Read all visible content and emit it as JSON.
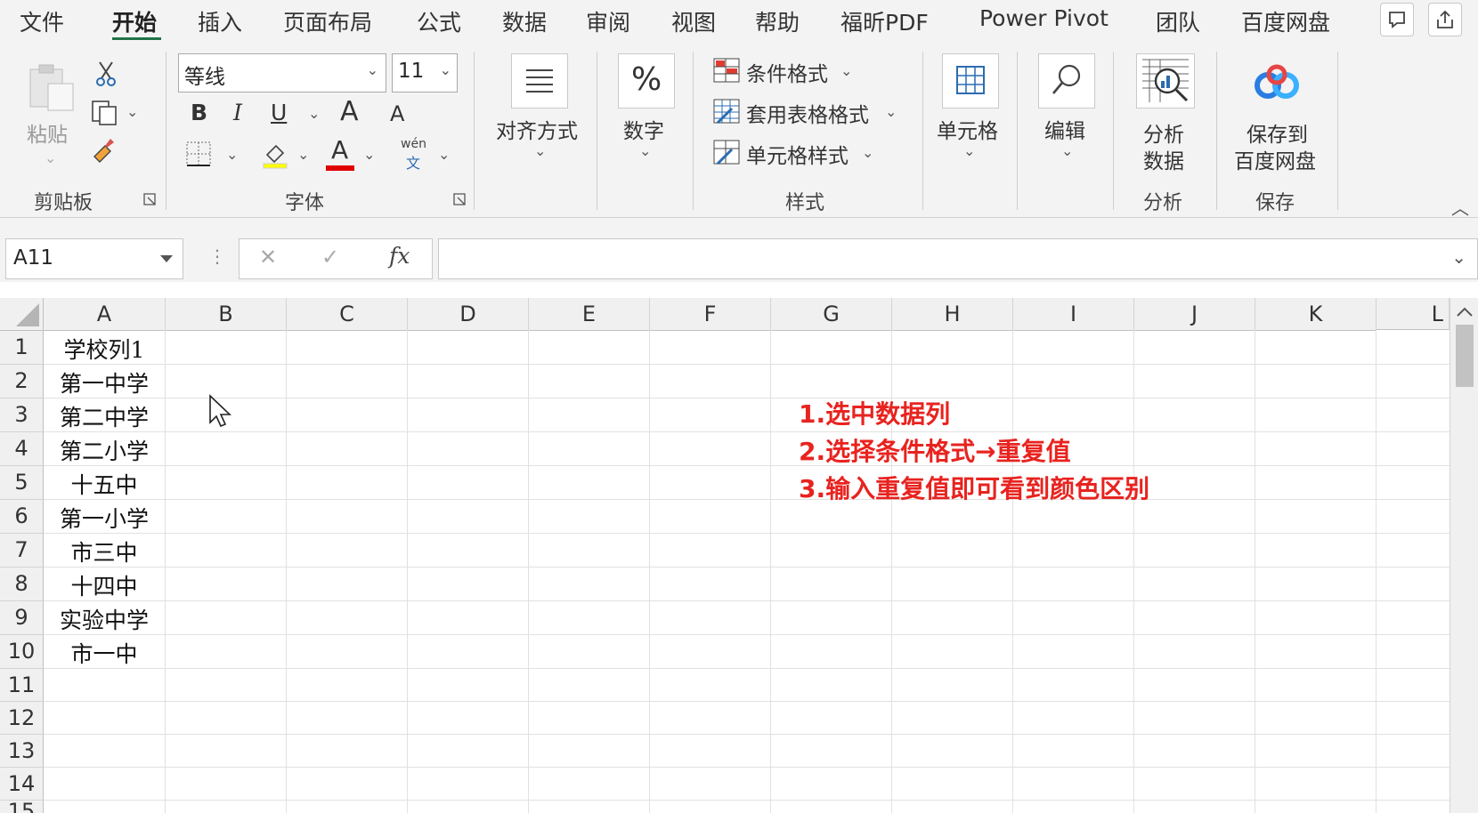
{
  "tabs": [
    "文件",
    "开始",
    "插入",
    "页面布局",
    "公式",
    "数据",
    "审阅",
    "视图",
    "帮助",
    "福昕PDF",
    "Power Pivot",
    "团队",
    "百度网盘"
  ],
  "active_tab": "开始",
  "ribbon": {
    "clipboard": {
      "paste_label": "粘贴",
      "group_label": "剪贴板"
    },
    "font": {
      "font_name": "等线",
      "font_size": "11",
      "group_label": "字体",
      "bold": "B",
      "italic": "I",
      "underline": "U",
      "grow": "A",
      "shrink": "A",
      "font_color": "A",
      "phonetic_top": "wén",
      "phonetic_bottom": "文"
    },
    "alignment": {
      "label": "对齐方式"
    },
    "number": {
      "label": "数字"
    },
    "styles": {
      "conditional": "条件格式",
      "table": "套用表格格式",
      "cell": "单元格样式",
      "group_label": "样式"
    },
    "cells": {
      "label": "单元格"
    },
    "editing": {
      "label": "编辑"
    },
    "analyze": {
      "line1": "分析",
      "line2": "数据",
      "group_label": "分析"
    },
    "save": {
      "line1": "保存到",
      "line2": "百度网盘",
      "group_label": "保存"
    }
  },
  "formula_bar": {
    "name_box": "A11",
    "cancel": "✕",
    "enter": "✓",
    "fx": "fx",
    "value": ""
  },
  "columns": [
    "A",
    "B",
    "C",
    "D",
    "E",
    "F",
    "G",
    "H",
    "I",
    "J",
    "K",
    "L"
  ],
  "rows": [
    "1",
    "2",
    "3",
    "4",
    "5",
    "6",
    "7",
    "8",
    "9",
    "10",
    "11",
    "12",
    "13",
    "14",
    "15"
  ],
  "cells_a": [
    "学校列1",
    "第一中学",
    "第二中学",
    "第二小学",
    "十五中",
    "第一小学",
    "市三中",
    "十四中",
    "实验中学",
    "市一中"
  ],
  "notes": [
    "1.选中数据列",
    "2.选择条件格式→重复值",
    "3.输入重复值即可看到颜色区别"
  ],
  "colors": {
    "accent": "#217346",
    "note": "#e8231f",
    "font_color_bar": "#e00000"
  }
}
